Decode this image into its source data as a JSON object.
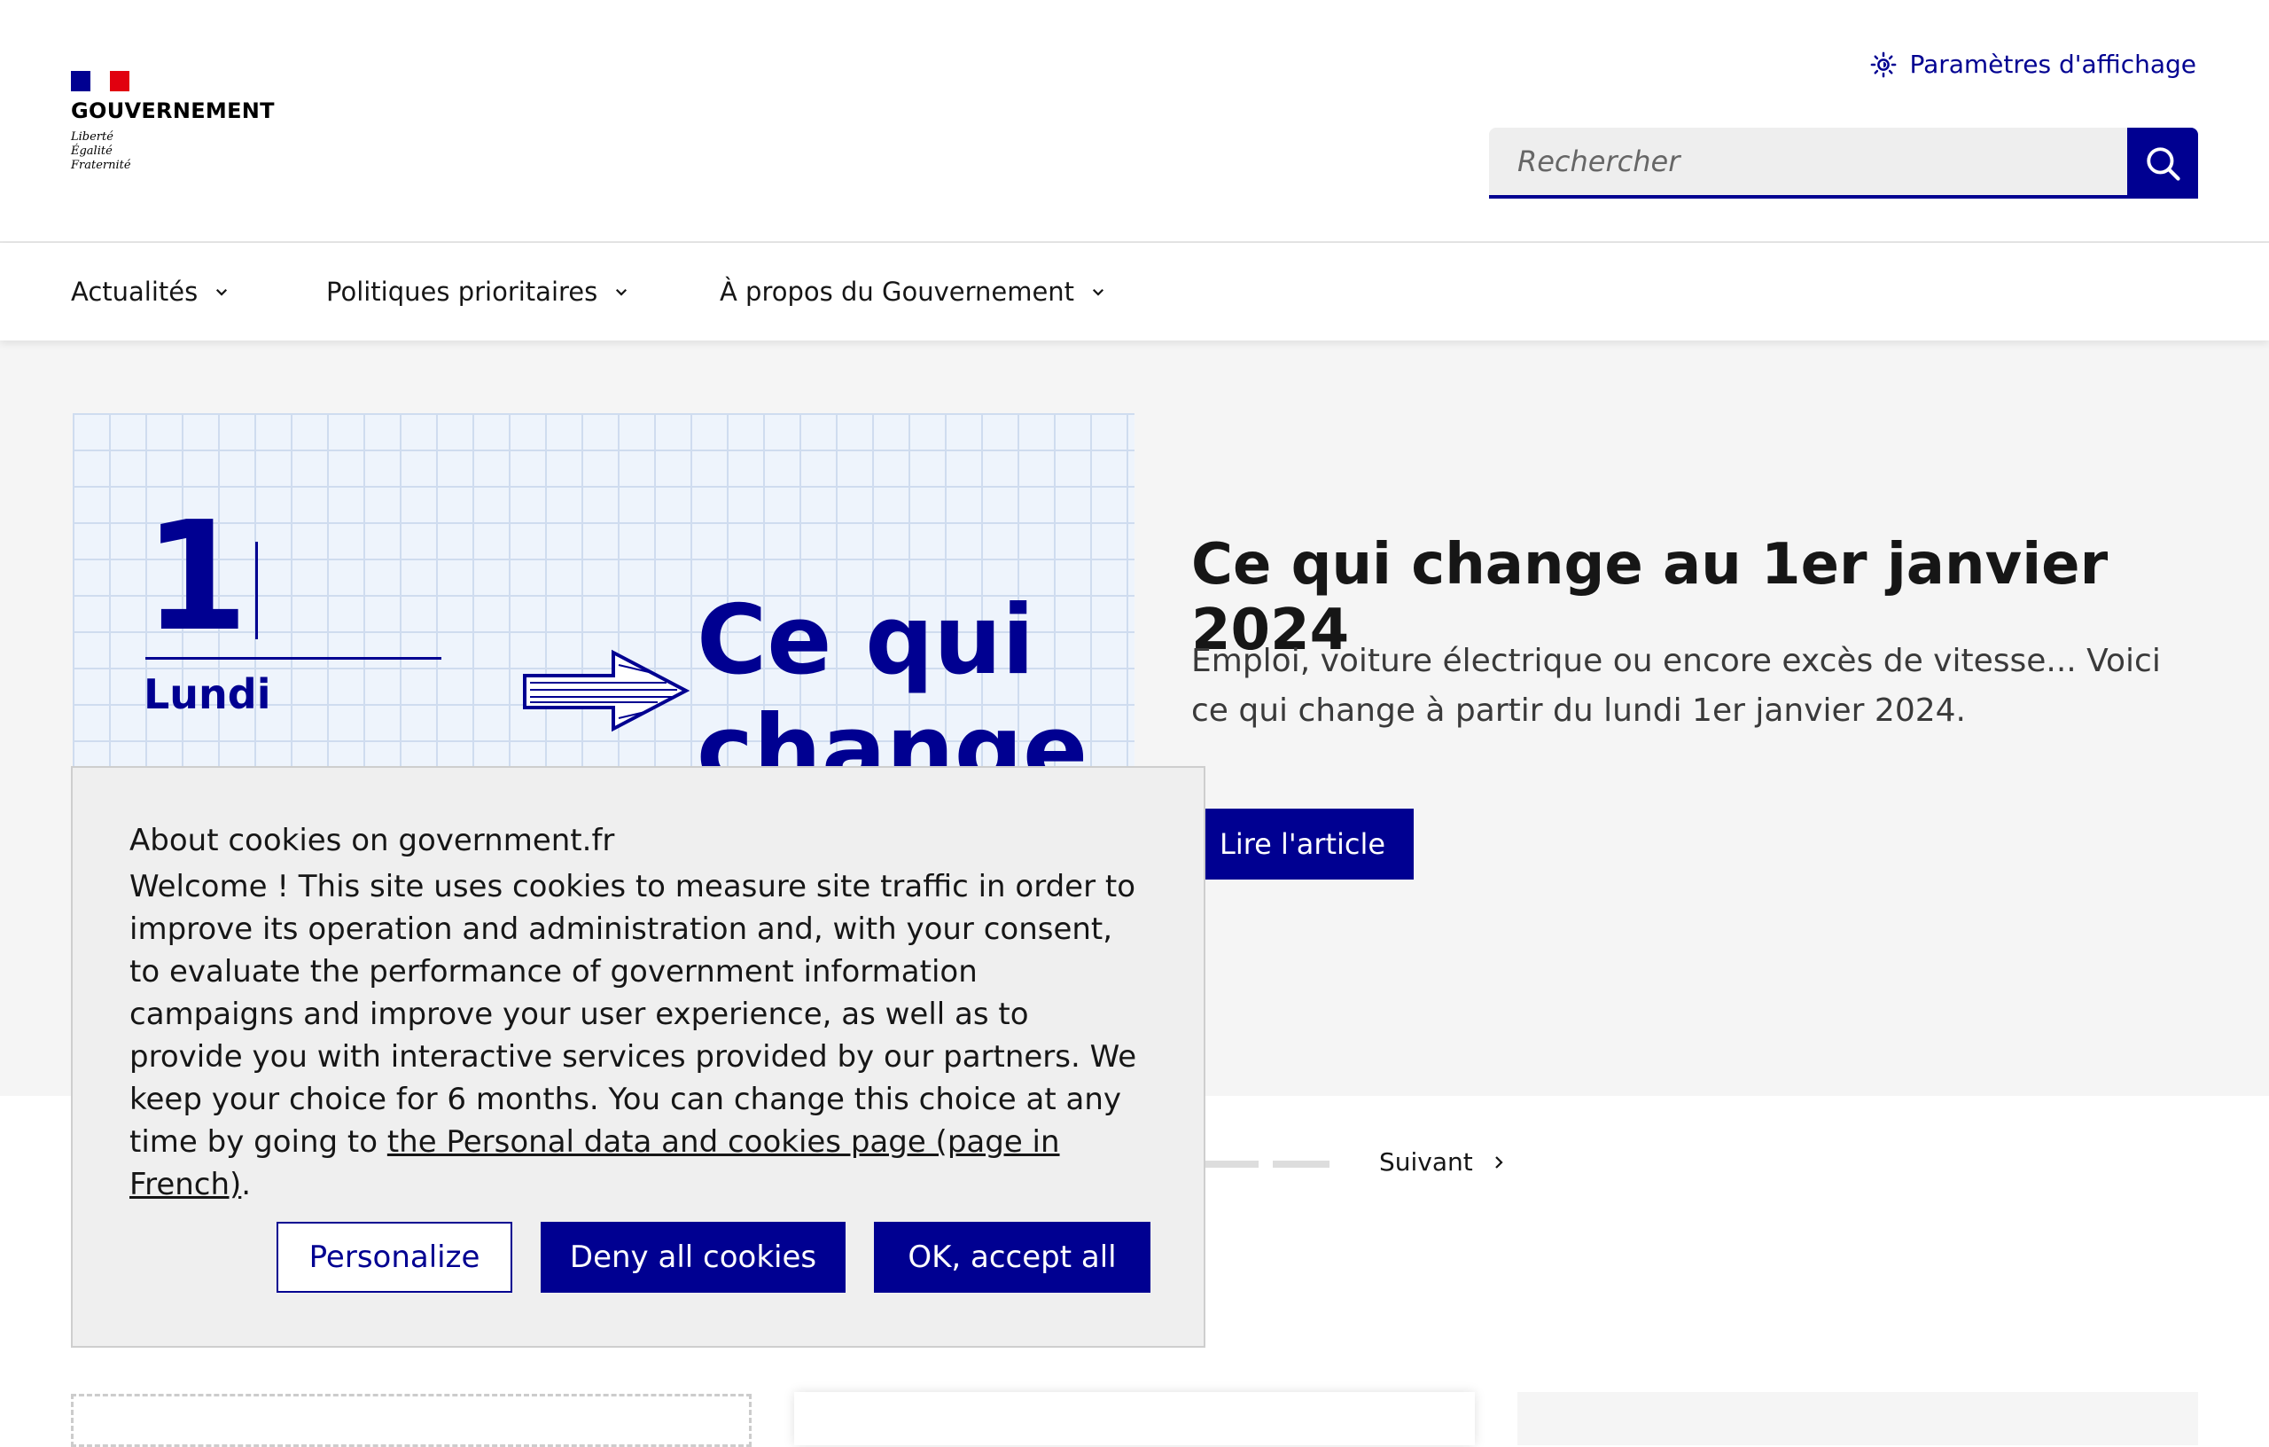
{
  "header": {
    "brand": "GOUVERNEMENT",
    "motto": [
      "Liberté",
      "Égalité",
      "Fraternité"
    ],
    "display_settings": "Paramètres d'affichage",
    "search_placeholder": "Rechercher"
  },
  "nav": {
    "items": [
      {
        "label": "Actualités"
      },
      {
        "label": "Politiques prioritaires"
      },
      {
        "label": "À propos du Gouvernement"
      }
    ]
  },
  "hero": {
    "image_text": {
      "number": "1",
      "day": "Lundi",
      "lines": [
        "Ce qui",
        "change"
      ]
    },
    "title": "Ce qui change au 1er janvier 2024",
    "description": "Emploi, voiture électrique ou encore excès de vitesse... Voici ce qui change à partir du lundi 1er janvier 2024.",
    "button": "Lire l'article"
  },
  "carousel": {
    "next": "Suivant"
  },
  "cookie_banner": {
    "title": "About cookies on government.fr",
    "body_before_link": "Welcome ! This site uses cookies to measure site traffic in order to improve its operation and administration and, with your consent, to evaluate the performance of government information campaigns and improve your user experience, as well as to provide you with interactive services provided by our partners. We keep your choice for 6 months. You can change this choice at any time by going to ",
    "link": "the Personal data and cookies page (page in French)",
    "body_after_link": ".",
    "buttons": {
      "personalize": "Personalize",
      "deny": "Deny all cookies",
      "accept": "OK, accept all"
    }
  },
  "colors": {
    "primary": "#000091",
    "flag_blue": "#000091",
    "flag_red": "#e1000f",
    "hero_bg": "#f5f5f5",
    "banner_bg": "#efefef",
    "accent_yellow": "#ffe552"
  }
}
